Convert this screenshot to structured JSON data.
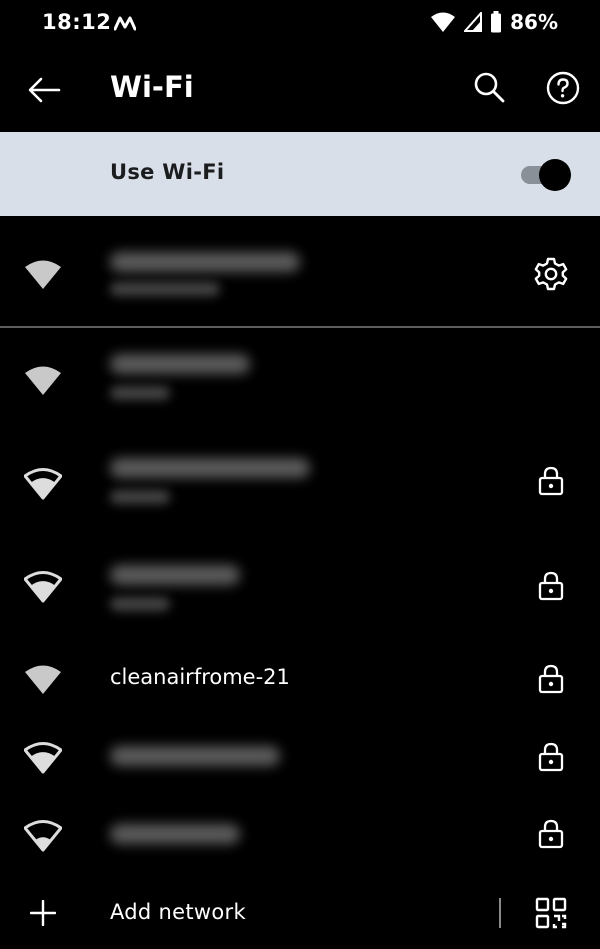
{
  "status_bar": {
    "time": "18:12",
    "notification_icon": "m-app-icon",
    "battery": "86%"
  },
  "app_bar": {
    "title": "Wi-Fi"
  },
  "wifi_toggle": {
    "label": "Use Wi-Fi",
    "on": true
  },
  "networks": [
    {
      "name": "cleanairfrome-21",
      "secured": true,
      "signal": "full"
    }
  ],
  "add_network": {
    "label": "Add network"
  },
  "colors": {
    "background": "#000000",
    "toggle_row": "#d9dfe8",
    "text": "#ffffff",
    "divider": "#5e5e5e"
  }
}
